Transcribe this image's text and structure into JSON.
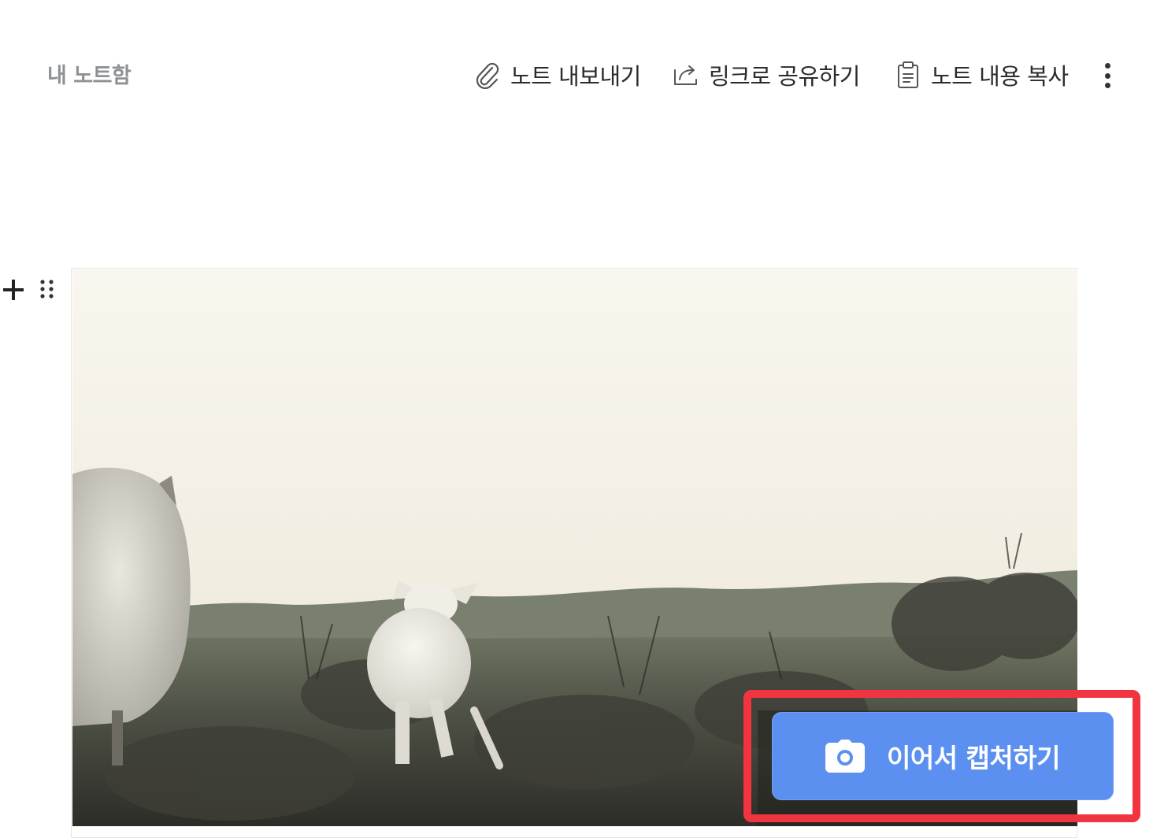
{
  "header": {
    "breadcrumb": "내 노트함",
    "actions": [
      {
        "label": "노트 내보내기",
        "icon": "paperclip-icon"
      },
      {
        "label": "링크로 공유하기",
        "icon": "share-icon"
      },
      {
        "label": "노트 내용 복사",
        "icon": "clipboard-icon"
      }
    ],
    "more_icon": "more-vertical-icon"
  },
  "block": {
    "add_icon": "plus-icon",
    "drag_icon": "drag-handle-icon"
  },
  "capture": {
    "label": "이어서 캡처하기",
    "icon": "camera-icon",
    "button_color": "#5b8ff0",
    "highlight_color": "#f23440"
  }
}
